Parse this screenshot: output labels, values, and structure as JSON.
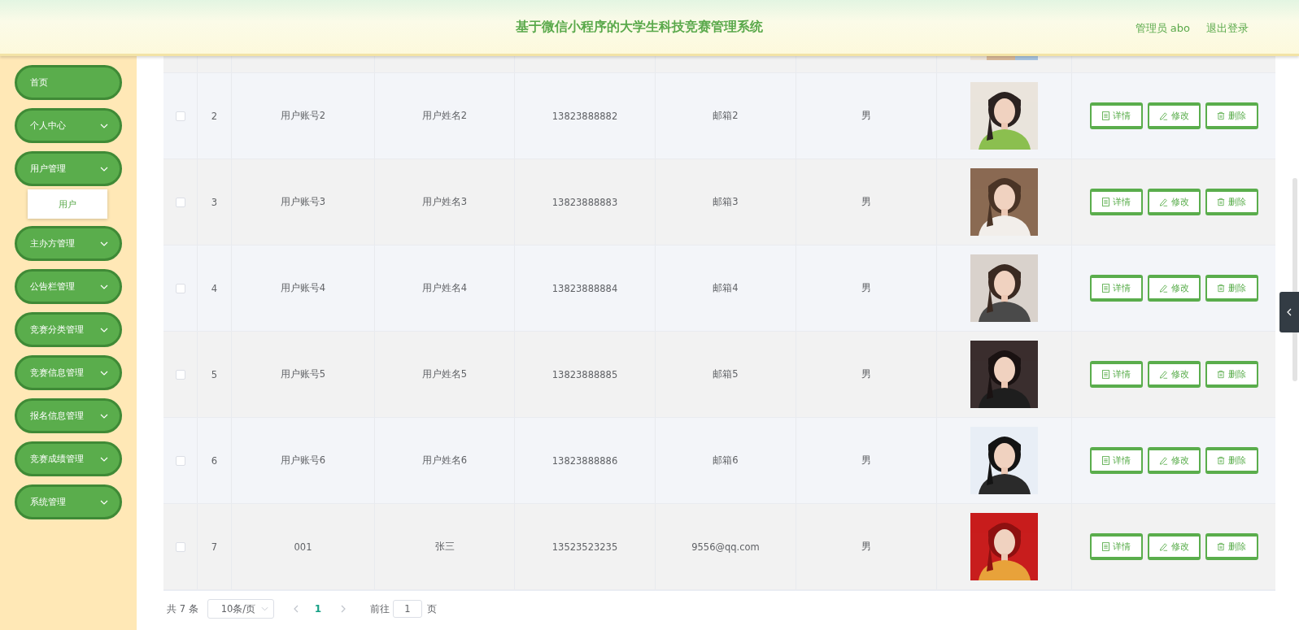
{
  "header": {
    "title": "基于微信小程序的大学生科技竞赛管理系统",
    "user": "管理员 abo",
    "logout": "退出登录"
  },
  "sidebar": {
    "items": [
      {
        "label": "首页",
        "kind": "link"
      },
      {
        "label": "个人中心",
        "kind": "group"
      },
      {
        "label": "用户管理",
        "kind": "group",
        "children": [
          {
            "label": "用户"
          }
        ]
      },
      {
        "label": "主办方管理",
        "kind": "group"
      },
      {
        "label": "公告栏管理",
        "kind": "group"
      },
      {
        "label": "竞赛分类管理",
        "kind": "group"
      },
      {
        "label": "竞赛信息管理",
        "kind": "group"
      },
      {
        "label": "报名信息管理",
        "kind": "group"
      },
      {
        "label": "竞赛成绩管理",
        "kind": "group"
      },
      {
        "label": "系统管理",
        "kind": "group"
      }
    ]
  },
  "table": {
    "rows": [
      {
        "selected": false,
        "index": "2",
        "account": "用户账号2",
        "name": "用户姓名2",
        "phone": "13823888882",
        "email": "邮箱2",
        "gender": "男",
        "actions": [
          "详情",
          "修改",
          "删除"
        ]
      },
      {
        "selected": false,
        "index": "3",
        "account": "用户账号3",
        "name": "用户姓名3",
        "phone": "13823888883",
        "email": "邮箱3",
        "gender": "男",
        "actions": [
          "详情",
          "修改",
          "删除"
        ]
      },
      {
        "selected": false,
        "index": "4",
        "account": "用户账号4",
        "name": "用户姓名4",
        "phone": "13823888884",
        "email": "邮箱4",
        "gender": "男",
        "actions": [
          "详情",
          "修改",
          "删除"
        ]
      },
      {
        "selected": false,
        "index": "5",
        "account": "用户账号5",
        "name": "用户姓名5",
        "phone": "13823888885",
        "email": "邮箱5",
        "gender": "男",
        "actions": [
          "详情",
          "修改",
          "删除"
        ]
      },
      {
        "selected": false,
        "index": "6",
        "account": "用户账号6",
        "name": "用户姓名6",
        "phone": "13823888886",
        "email": "邮箱6",
        "gender": "男",
        "actions": [
          "详情",
          "修改",
          "删除"
        ]
      },
      {
        "selected": false,
        "index": "7",
        "account": "001",
        "name": "张三",
        "phone": "13523523235",
        "email": "9556@qq.com",
        "gender": "男",
        "actions": [
          "详情",
          "修改",
          "删除"
        ]
      }
    ]
  },
  "pagination": {
    "total": "共 7 条",
    "page_size": "10条/页",
    "pages": [
      {
        "label": "1",
        "selected": true
      }
    ],
    "goto_label": "前往",
    "goto_value": "1",
    "goto_suffix": "页"
  }
}
